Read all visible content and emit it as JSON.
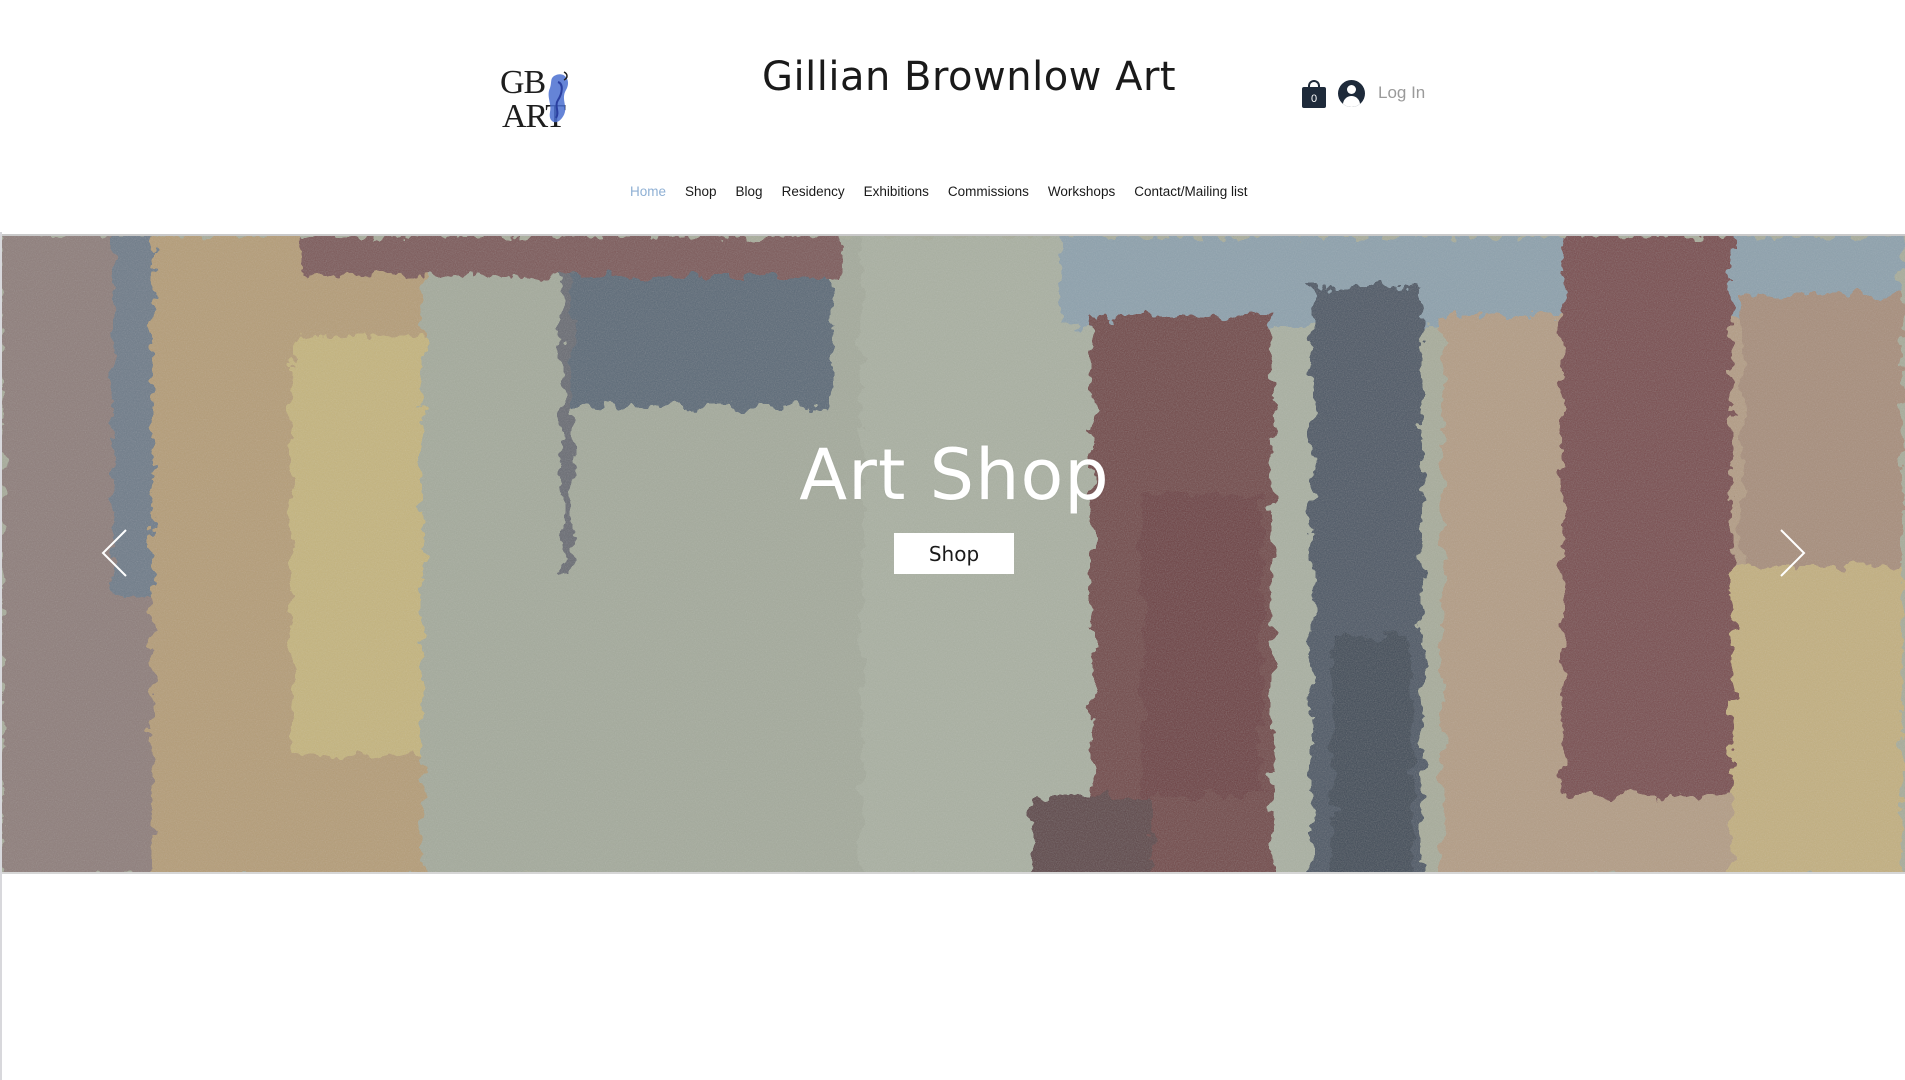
{
  "header": {
    "logo_text_top": "GB",
    "logo_text_bottom": "ART",
    "site_title": "Gillian Brownlow Art",
    "cart_count": "0",
    "login_label": "Log In"
  },
  "nav": {
    "items": [
      {
        "label": "Home",
        "active": true
      },
      {
        "label": "Shop",
        "active": false
      },
      {
        "label": "Blog",
        "active": false
      },
      {
        "label": "Residency",
        "active": false
      },
      {
        "label": "Exhibitions",
        "active": false
      },
      {
        "label": "Commissions",
        "active": false
      },
      {
        "label": "Workshops",
        "active": false
      },
      {
        "label": "Contact/Mailing list",
        "active": false
      }
    ]
  },
  "hero": {
    "title": "Art Shop",
    "button_label": "Shop",
    "prev_icon": "chevron-left-icon",
    "next_icon": "chevron-right-icon"
  },
  "colors": {
    "nav_active": "#8fb0d4",
    "text_dark": "#1a1a1a",
    "icon_navy": "#1e2a3a",
    "login_grey": "#9a9a9a"
  }
}
